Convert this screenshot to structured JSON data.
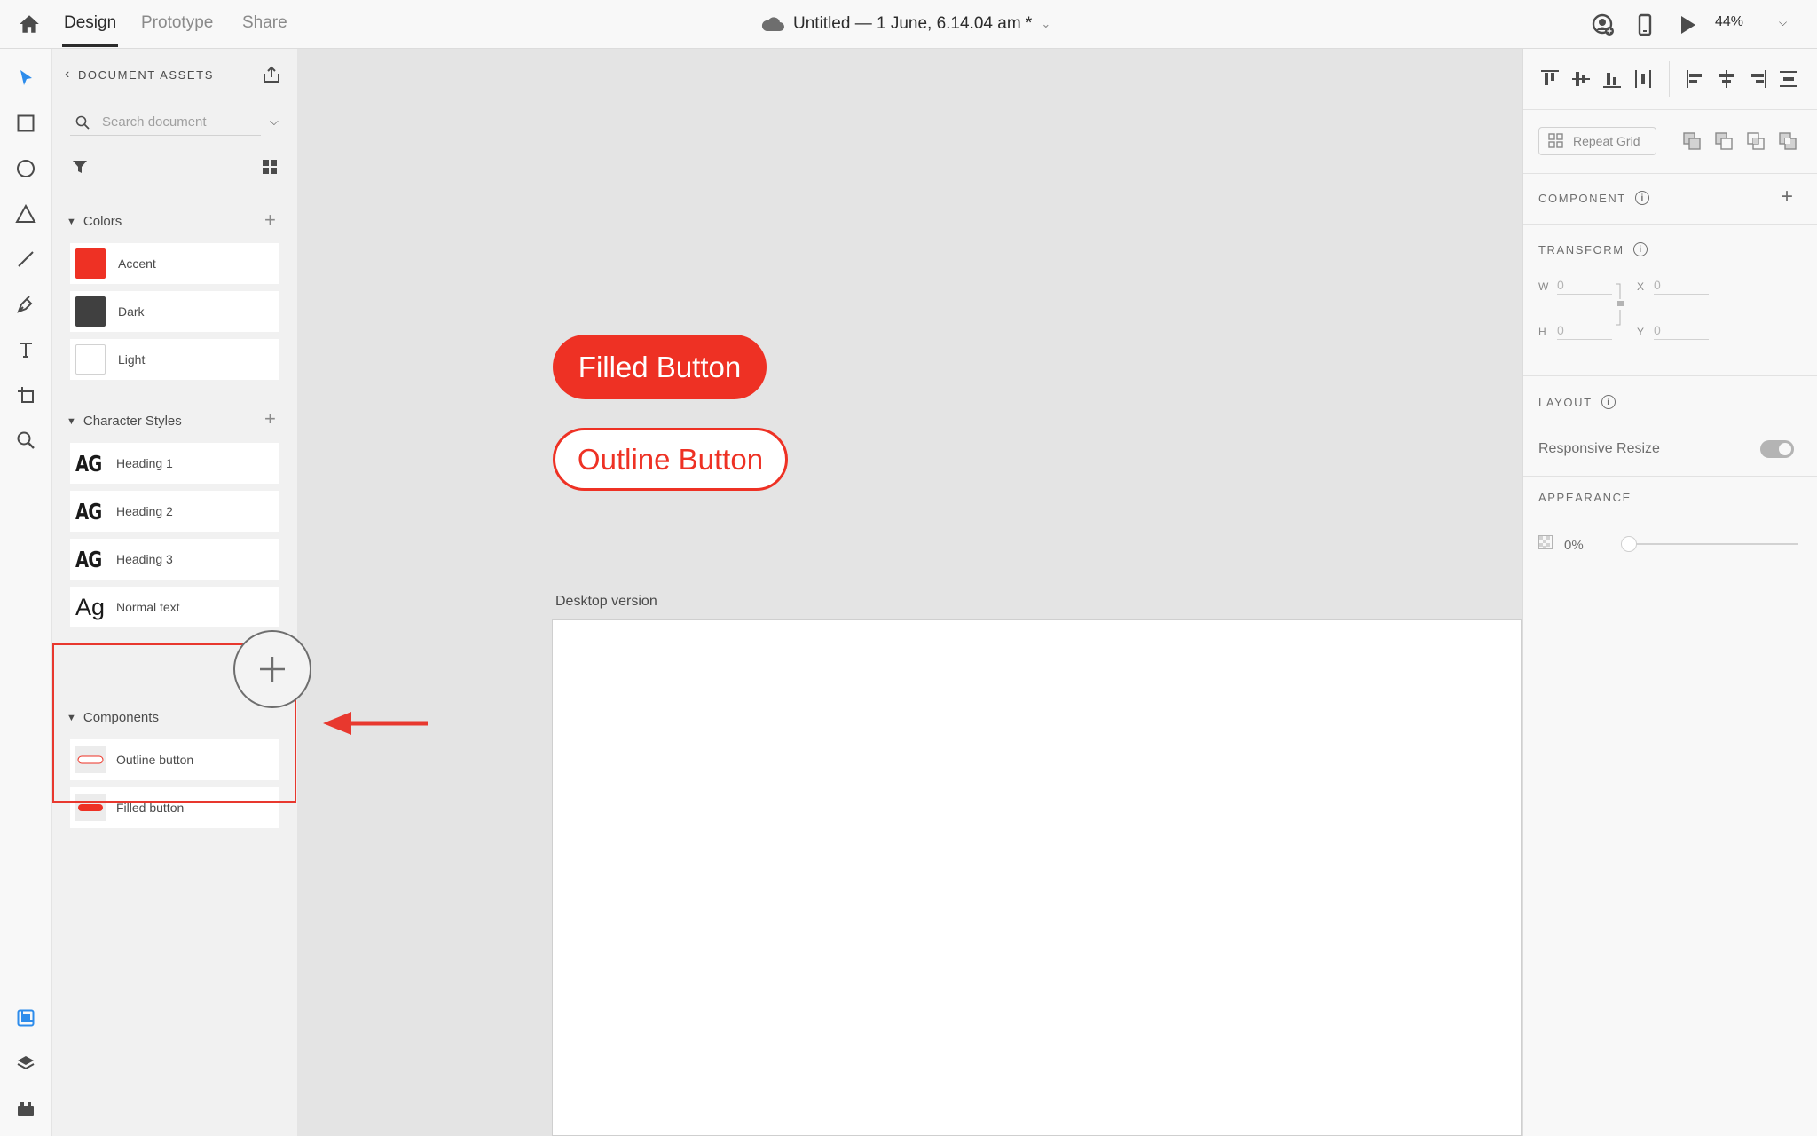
{
  "topbar": {
    "tabs": [
      {
        "label": "Design",
        "active": true
      },
      {
        "label": "Prototype",
        "active": false
      },
      {
        "label": "Share",
        "active": false
      }
    ],
    "doc_title": "Untitled — 1 June, 6.14.04 am *",
    "zoom": "44%"
  },
  "left_tools": [
    "select-icon",
    "rectangle-icon",
    "ellipse-icon",
    "polygon-icon",
    "line-icon",
    "pen-icon",
    "text-icon",
    "artboard-icon",
    "zoom-icon"
  ],
  "bottom_tools": [
    "assets-icon",
    "layers-icon",
    "plugins-icon"
  ],
  "assets": {
    "header": "DOCUMENT ASSETS",
    "search_placeholder": "Search document",
    "colors": {
      "title": "Colors",
      "items": [
        {
          "label": "Accent",
          "color": "#ee3124"
        },
        {
          "label": "Dark",
          "color": "#404040"
        },
        {
          "label": "Light",
          "color": "#ffffff"
        }
      ]
    },
    "character_styles": {
      "title": "Character Styles",
      "items": [
        {
          "preview": "AG",
          "label": "Heading 1"
        },
        {
          "preview": "AG",
          "label": "Heading 2"
        },
        {
          "preview": "AG",
          "label": "Heading 3"
        },
        {
          "preview": "Ag",
          "label": "Normal text"
        }
      ]
    },
    "components": {
      "title": "Components",
      "items": [
        {
          "label": "Outline button"
        },
        {
          "label": "Filled button"
        }
      ]
    }
  },
  "canvas": {
    "filled_button": "Filled Button",
    "outline_button": "Outline Button",
    "artboard_label": "Desktop version"
  },
  "props": {
    "repeat_grid": "Repeat Grid",
    "component_title": "COMPONENT",
    "transform_title": "TRANSFORM",
    "w_label": "W",
    "w_value": "0",
    "x_label": "X",
    "x_value": "0",
    "h_label": "H",
    "h_value": "0",
    "y_label": "Y",
    "y_value": "0",
    "layout_title": "LAYOUT",
    "responsive_resize": "Responsive Resize",
    "appearance_title": "APPEARANCE",
    "opacity": "0%"
  },
  "colors": {
    "accent": "#ee3124",
    "tool_active": "#2d8ceb"
  }
}
